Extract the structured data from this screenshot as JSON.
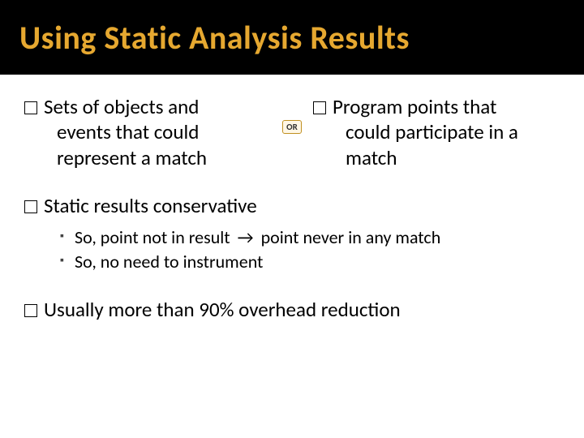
{
  "title": "Using Static Analysis Results",
  "left_col": {
    "line1": "Sets of objects and",
    "line2": "events that could represent a match"
  },
  "or_label": "OR",
  "right_col": {
    "line1": "Program points that",
    "line2": "could participate in a match"
  },
  "bullet_conservative": "Static results conservative",
  "sub1_a": "So, point not in result",
  "sub1_arrow": "→",
  "sub1_b": "point never in any match",
  "sub2": "So, no need to instrument",
  "bullet_overhead": "Usually more than 90% overhead reduction"
}
